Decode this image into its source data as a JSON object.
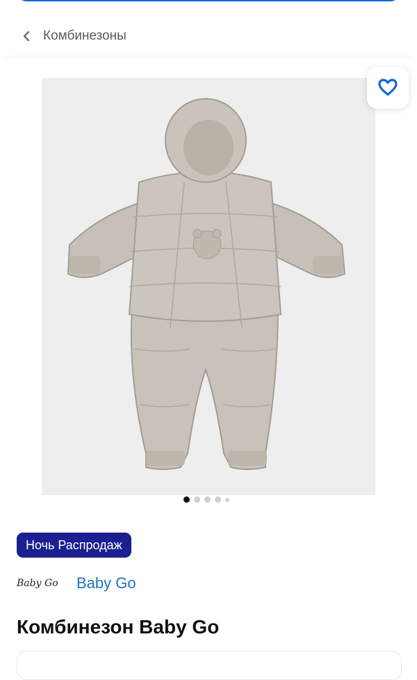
{
  "header": {
    "title": "Комбинезоны",
    "back_icon": "chevron-left-icon"
  },
  "gallery": {
    "image_alt": "Комбинезон Baby Go",
    "slides": 5,
    "active_slide": 1,
    "favorite_icon": "heart-icon"
  },
  "promo": {
    "label": "Ночь Распродаж"
  },
  "brand": {
    "logo_text": "Baby Go",
    "link_text": "Baby Go"
  },
  "product": {
    "title": "Комбинезон Baby Go"
  },
  "colors": {
    "accent": "#1565d8",
    "promo_bg": "#1b1f8f",
    "brand_link": "#1e73be"
  }
}
